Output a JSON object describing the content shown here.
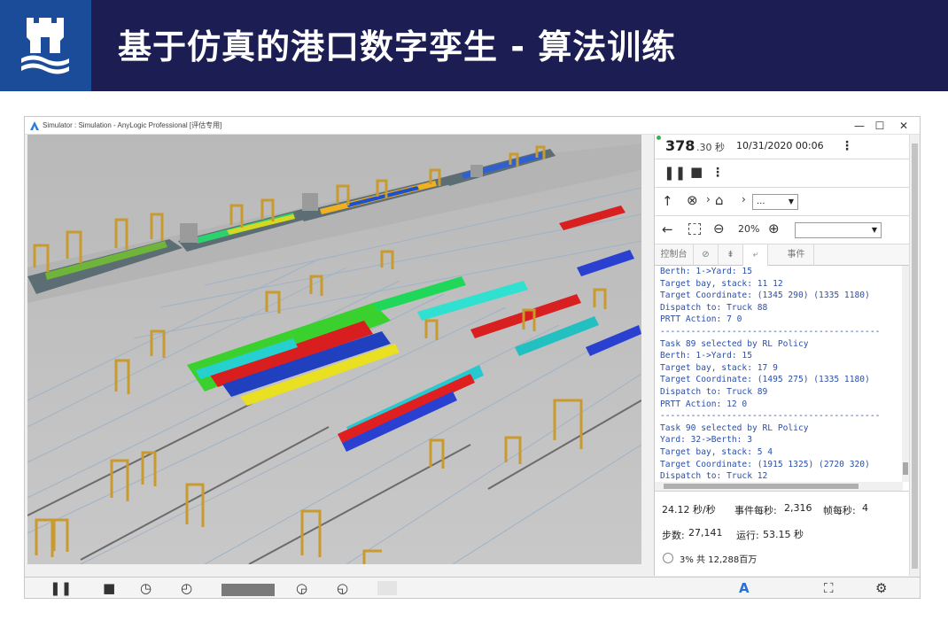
{
  "banner": {
    "title": "基于仿真的港口数字孪生 - 算法训练",
    "logo": "university-castle-logo"
  },
  "window": {
    "title": "Simulator : Simulation - AnyLogic Professional [评估专用]",
    "controls": {
      "minimize": "—",
      "maximize": "☐",
      "close": "✕"
    }
  },
  "panel": {
    "time_value": "378",
    "time_fraction": ".30 秒",
    "date": "10/31/2020 00:06",
    "zoom": "20%",
    "nav_dropdown": "...",
    "tabs": [
      "控制台",
      "",
      "",
      "",
      "事件"
    ],
    "console_lines": [
      "Berth: 1->Yard: 15",
      "Target bay, stack: 11 12",
      "Target Coordinate: (1345 290) (1335 1180)",
      "Dispatch to: Truck 88",
      "PRTT Action: 7 0",
      "-------------------------------------------",
      "Task 89 selected by RL Policy",
      "Berth: 1->Yard: 15",
      "Target bay, stack: 17 9",
      "Target Coordinate: (1495 275) (1335 1180)",
      "Dispatch to: Truck 89",
      "PRTT Action: 12 0",
      "-------------------------------------------",
      "Task 90 selected by RL Policy",
      "Yard: 32->Berth: 3",
      "Target bay, stack: 5 4",
      "Target Coordinate: (1915 1325) (2720 320)",
      "Dispatch to: Truck 12"
    ],
    "stats": {
      "speed": "24.12 秒/秒",
      "events_label": "事件每秒:",
      "events_value": "2,316",
      "fps_label": "帧每秒:",
      "fps_value": "4",
      "steps_label": "步数:",
      "steps_value": "27,141",
      "run_label": "运行:",
      "run_value": "53.15 秒",
      "memory": "3% 共 12,288百万"
    }
  },
  "icons": {
    "pause": "pause-icon",
    "stop": "stop-icon",
    "up": "arrow-up-icon",
    "cancel": "cancel-icon",
    "home": "home-icon",
    "back": "arrow-left-icon",
    "zoom_out": "zoom-out-icon",
    "zoom_in": "zoom-in-icon"
  },
  "colors": {
    "banner": "#1c1d52",
    "logo_bg": "#1a4c9a",
    "console_text": "#2a4fa8"
  }
}
